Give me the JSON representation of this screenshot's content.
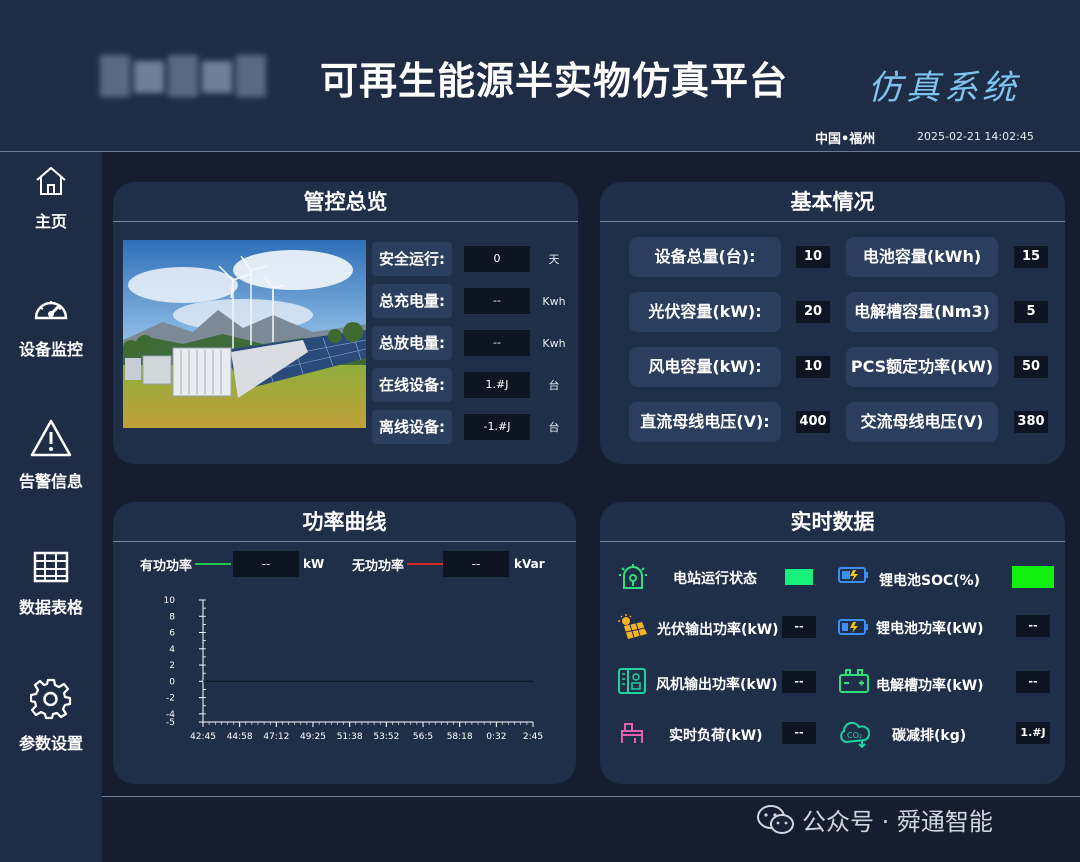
{
  "header": {
    "title": "可再生能源半实物仿真平台",
    "subtitle": "仿真系统",
    "location": "中国•福州",
    "datetime": "2025-02-21 14:02:45"
  },
  "sidebar": {
    "items": [
      {
        "label": "主页",
        "icon": "home-icon"
      },
      {
        "label": "设备监控",
        "icon": "gauge-icon"
      },
      {
        "label": "告警信息",
        "icon": "warning-icon"
      },
      {
        "label": "数据表格",
        "icon": "table-icon"
      },
      {
        "label": "参数设置",
        "icon": "gear-icon"
      }
    ]
  },
  "overview": {
    "title": "管控总览",
    "rows": [
      {
        "label": "安全运行:",
        "value": "0",
        "unit": "天"
      },
      {
        "label": "总充电量:",
        "value": "--",
        "unit": "Kwh"
      },
      {
        "label": "总放电量:",
        "value": "--",
        "unit": "Kwh"
      },
      {
        "label": "在线设备:",
        "value": "1.#J",
        "unit": "台"
      },
      {
        "label": "离线设备:",
        "value": "-1.#J",
        "unit": "台"
      }
    ]
  },
  "basic": {
    "title": "基本情况",
    "items": [
      {
        "label": "设备总量(台):",
        "value": "10"
      },
      {
        "label": "电池容量(kWh)",
        "value": "15"
      },
      {
        "label": "光伏容量(kW):",
        "value": "20"
      },
      {
        "label": "电解槽容量(Nm3)",
        "value": "5"
      },
      {
        "label": "风电容量(kW):",
        "value": "10"
      },
      {
        "label": "PCS额定功率(kW)",
        "value": "50"
      },
      {
        "label": "直流母线电压(V):",
        "value": "400"
      },
      {
        "label": "交流母线电压(V)",
        "value": "380"
      }
    ]
  },
  "power": {
    "title": "功率曲线",
    "active_label": "有功功率",
    "active_value": "--",
    "active_unit": "kW",
    "reactive_label": "无功功率",
    "reactive_value": "--",
    "reactive_unit": "kVar",
    "active_color": "#22c84a",
    "reactive_color": "#d42a2a"
  },
  "chart_data": {
    "type": "line",
    "x": [
      "42:45",
      "44:58",
      "47:12",
      "49:25",
      "51:38",
      "53:52",
      "56:5",
      "58:18",
      "0:32",
      "2:45"
    ],
    "y_ticks": [
      10,
      8,
      6,
      4,
      2,
      0,
      -2,
      -4,
      -5
    ],
    "ylim": [
      -5,
      10
    ],
    "series": [
      {
        "name": "有功功率",
        "values": [
          0,
          0,
          0,
          0,
          0,
          0,
          0,
          0,
          0,
          0
        ]
      }
    ]
  },
  "realtime": {
    "title": "实时数据",
    "items": [
      {
        "label": "电站运行状态",
        "value": "",
        "icon": "station-icon",
        "status_color": "#17f07a"
      },
      {
        "label": "锂电池SOC(%)",
        "value": "",
        "icon": "battery-icon",
        "status_color": "#12f012"
      },
      {
        "label": "光伏输出功率(kW)",
        "value": "--",
        "icon": "solar-panel-icon"
      },
      {
        "label": "锂电池功率(kW)",
        "value": "--",
        "icon": "battery-charging-icon"
      },
      {
        "label": "风机输出功率(kW)",
        "value": "--",
        "icon": "wind-turbine-icon"
      },
      {
        "label": "电解槽功率(kW)",
        "value": "--",
        "icon": "electrolyzer-icon"
      },
      {
        "label": "实时负荷(kW)",
        "value": "--",
        "icon": "load-icon"
      },
      {
        "label": "碳减排(kg)",
        "value": "1.#J",
        "icon": "co2-icon"
      }
    ]
  },
  "watermark": "公众号 · 舜通智能"
}
